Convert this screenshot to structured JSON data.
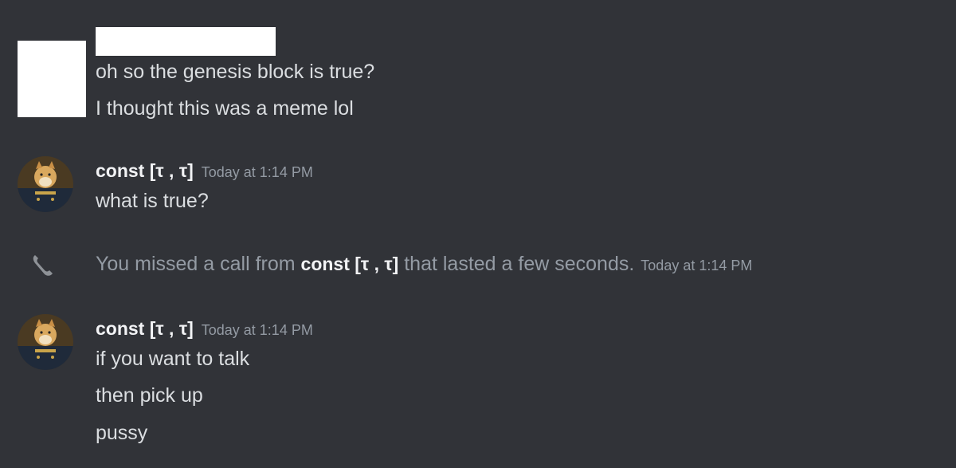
{
  "messages": {
    "first_group": {
      "lines": [
        "oh so the genesis block is true?",
        "I thought this was a meme lol"
      ]
    },
    "second_group": {
      "username": "const [τ , τ]",
      "timestamp": "Today at 1:14 PM",
      "lines": [
        "what is true?"
      ]
    },
    "missed_call": {
      "prefix": "You missed a call from",
      "caller": "const [τ , τ]",
      "suffix": "that lasted a few seconds.",
      "timestamp": "Today at 1:14 PM",
      "icon": "phone-missed-icon"
    },
    "third_group": {
      "username": "const [τ , τ]",
      "timestamp": "Today at 1:14 PM",
      "lines": [
        "if you want to talk",
        "then pick up",
        "pussy"
      ]
    }
  },
  "colors": {
    "background": "#313338",
    "text": "#dbdee1",
    "username": "#f2f3f5",
    "muted": "#949ba4"
  }
}
